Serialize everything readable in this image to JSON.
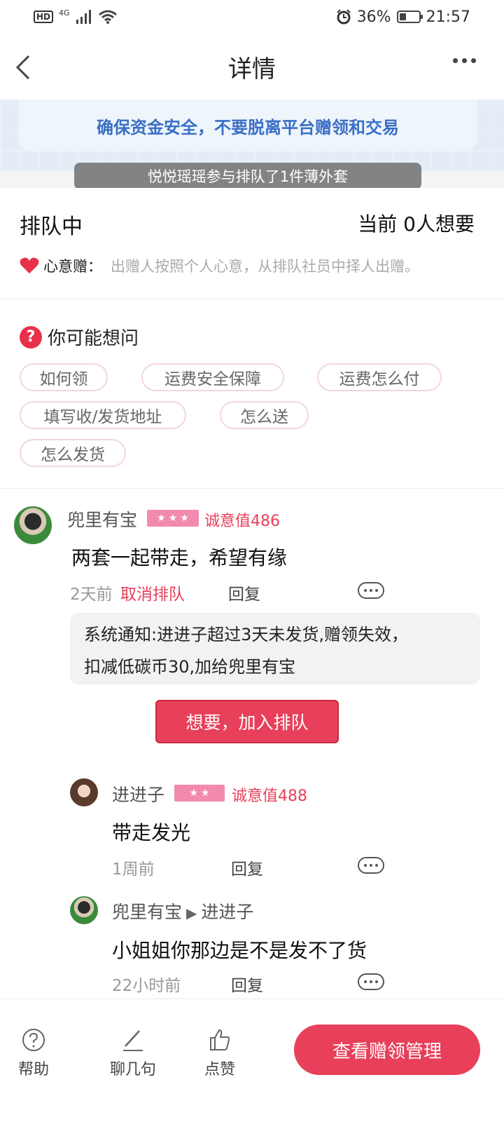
{
  "status_bar": {
    "hd": "HD",
    "network": "4G",
    "battery_percent": "36%",
    "battery_level": 0.36,
    "time": "21:57"
  },
  "header": {
    "title": "详情"
  },
  "banner": {
    "text": "确保资金安全，不要脱离平台赠领和交易"
  },
  "toast": {
    "text": "悦悦瑶瑶参与排队了1件薄外套"
  },
  "queue": {
    "status": "排队中",
    "current_count": "当前 0人想要",
    "mode_label": "心意赠：",
    "mode_desc": "出赠人按照个人心意，从排队社员中择人出赠。"
  },
  "faq": {
    "title": "你可能想问",
    "chips": [
      "如何领",
      "运费安全保障",
      "运费怎么付",
      "填写收/发货地址",
      "怎么送",
      "怎么发货"
    ]
  },
  "comments": {
    "main": {
      "user": "兜里有宝",
      "stars": "★★★",
      "sincerity": "诚意值486",
      "text": "两套一起带走，希望有缘",
      "time": "2天前",
      "cancel": "取消排队",
      "reply": "回复",
      "notice_line1": "系统通知:进进子超过3天未发货,赠领失效，",
      "notice_line2": "扣减低碳币30,加给兜里有宝",
      "join_button": "想要，加入排队"
    },
    "reply1": {
      "user": "进进子",
      "stars": "★★",
      "sincerity": "诚意值488",
      "text": "带走发光",
      "time": "1周前",
      "reply": "回复"
    },
    "reply2": {
      "user": "兜里有宝",
      "arrow": "▶",
      "target": "进进子",
      "text": "小姐姐你那边是不是发不了货",
      "time": "22小时前",
      "reply": "回复"
    }
  },
  "bottom_bar": {
    "help": "帮助",
    "chat": "聊几句",
    "like": "点赞",
    "manage": "查看赠领管理"
  },
  "colors": {
    "accent": "#e8405a",
    "banner_text": "#3a6fc6"
  }
}
